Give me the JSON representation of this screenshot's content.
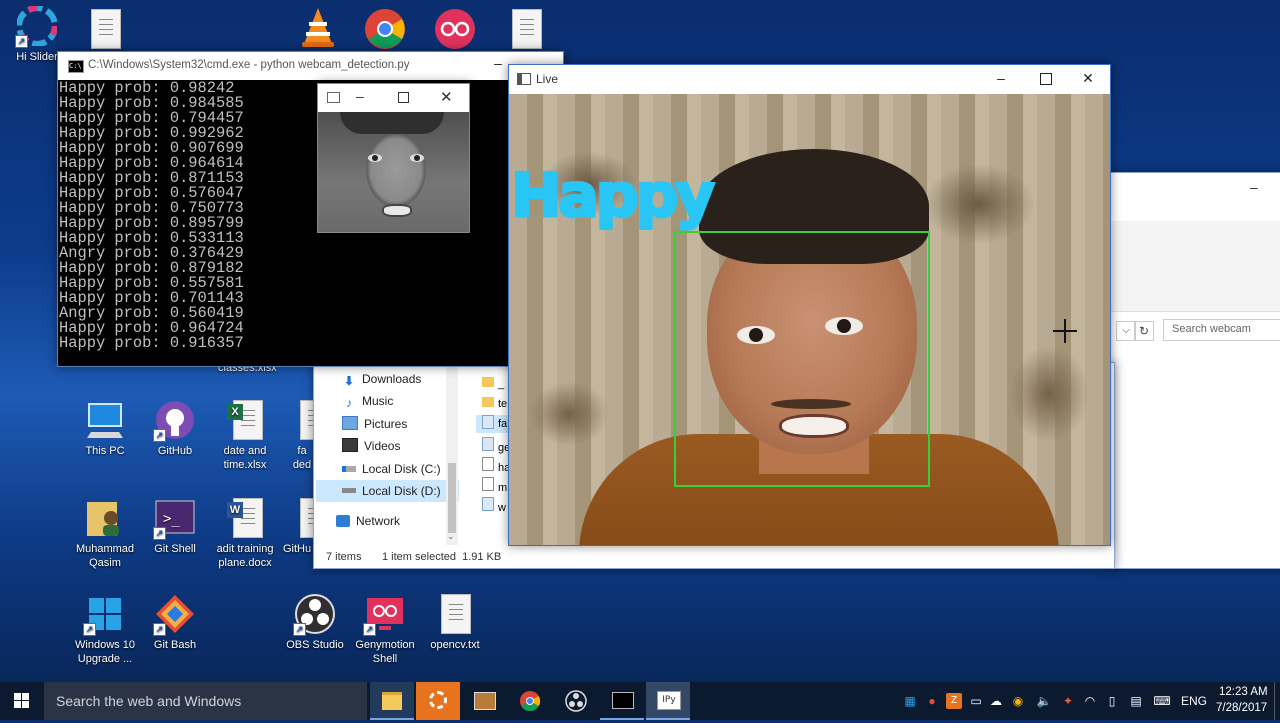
{
  "desktop": {
    "icons": [
      {
        "label": "Hi Slider",
        "icon": "hi-slider-icon"
      },
      {
        "label": "classes.xlsx",
        "icon": "excel-file-icon"
      },
      {
        "label": "This PC",
        "icon": "computer-icon"
      },
      {
        "label": "GitHub",
        "icon": "github-icon"
      },
      {
        "label": "date and time.xlsx",
        "icon": "excel-file-icon"
      },
      {
        "label": "fa ded",
        "icon": "file-icon"
      },
      {
        "label": "Muhammad Qasim",
        "icon": "user-folder-icon"
      },
      {
        "label": "Git Shell",
        "icon": "terminal-icon"
      },
      {
        "label": "adit training plane.docx",
        "icon": "word-file-icon"
      },
      {
        "label": "GitHu",
        "icon": "file-icon"
      },
      {
        "label": "Windows 10 Upgrade ...",
        "icon": "windows-upgrade-icon"
      },
      {
        "label": "Git Bash",
        "icon": "git-bash-icon"
      },
      {
        "label": "OBS Studio",
        "icon": "obs-icon"
      },
      {
        "label": "Genymotion Shell",
        "icon": "genymotion-icon"
      },
      {
        "label": "opencv.txt",
        "icon": "text-file-icon"
      }
    ]
  },
  "cmd": {
    "title": "C:\\Windows\\System32\\cmd.exe - python  webcam_detection.py",
    "lines": [
      "Happy prob: 0.98242",
      "Happy prob: 0.984585",
      "Happy prob: 0.794457",
      "Happy prob: 0.992962",
      "Happy prob: 0.907699",
      "Happy prob: 0.964614",
      "Happy prob: 0.871153",
      "Happy prob: 0.576047",
      "Happy prob: 0.750773",
      "Happy prob: 0.895799",
      "Happy prob: 0.533113",
      "Angry prob: 0.376429",
      "Happy prob: 0.879182",
      "Happy prob: 0.557581",
      "Happy prob: 0.701143",
      "Angry prob: 0.560419",
      "Happy prob: 0.964724",
      "Happy prob: 0.916357"
    ]
  },
  "live": {
    "title": "Live",
    "emotion_label": "Happy",
    "emotion_color": "#29c6f5",
    "box_color": "#36d13a"
  },
  "explorer": {
    "nav": [
      "Downloads",
      "Music",
      "Pictures",
      "Videos",
      "Local Disk (C:)",
      "Local Disk (D:)",
      "Network"
    ],
    "files": [
      "_",
      "te",
      "fa",
      "ge",
      "ha",
      "m",
      "w"
    ],
    "search_placeholder": "Search webcam",
    "status_items": "7 items",
    "status_selected": "1 item selected  1.91 KB"
  },
  "taskbar": {
    "search_placeholder": "Search the web and Windows",
    "lang": "ENG",
    "time": "12:23 AM",
    "date": "7/28/2017"
  }
}
